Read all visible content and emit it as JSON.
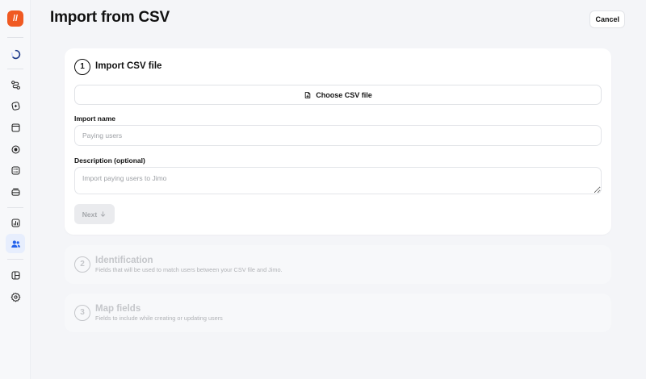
{
  "header": {
    "title": "Import from CSV",
    "cancel_label": "Cancel"
  },
  "sidebar": {
    "logo": "//",
    "items": [
      {
        "name": "loader-icon"
      },
      {
        "name": "flows-icon"
      },
      {
        "name": "tours-icon"
      },
      {
        "name": "boosted-icon"
      },
      {
        "name": "hotspot-icon"
      },
      {
        "name": "checklist-icon"
      },
      {
        "name": "stack-icon"
      },
      {
        "name": "analytics-icon"
      },
      {
        "name": "users-icon",
        "active": true
      },
      {
        "name": "layout-icon"
      },
      {
        "name": "gear-icon"
      }
    ]
  },
  "steps": [
    {
      "number": "1",
      "title": "Import CSV file",
      "state": "active"
    },
    {
      "number": "2",
      "title": "Identification",
      "subtitle": "Fields that will be used to match users between your CSV file and Jimo.",
      "state": "disabled"
    },
    {
      "number": "3",
      "title": "Map fields",
      "subtitle": "Fields to include while creating or updating users",
      "state": "disabled"
    }
  ],
  "form": {
    "choose_file_label": "Choose CSV file",
    "import_name": {
      "label": "Import name",
      "placeholder": "Paying users",
      "value": ""
    },
    "description": {
      "label": "Description (optional)",
      "placeholder": "Import paying users to Jimo",
      "value": ""
    },
    "next_label": "Next",
    "next_icon": "arrow-down-icon"
  },
  "colors": {
    "brand": "#f05a22",
    "active_nav": "#2563eb",
    "disabled_text": "#c4c6ca"
  }
}
